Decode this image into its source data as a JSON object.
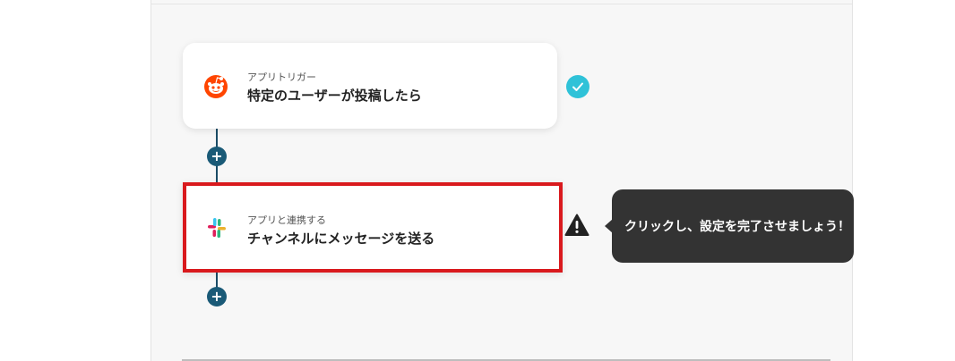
{
  "flow": {
    "steps": [
      {
        "kicker": "アプリトリガー",
        "title": "特定のユーザーが投稿したら",
        "app_icon": "reddit-icon",
        "status": "complete",
        "status_icon": "check-circle-icon"
      },
      {
        "kicker": "アプリと連携する",
        "title": "チャンネルにメッセージを送る",
        "app_icon": "slack-icon",
        "status": "warning",
        "status_icon": "warning-triangle-icon"
      }
    ],
    "add_step_icon": "+",
    "tooltip": "クリックし、設定を完了させましょう！"
  },
  "colors": {
    "check": "#2fc2d8",
    "highlight": "#d9191d",
    "connector": "#1a5a77",
    "tooltip_bg": "#333333",
    "reddit": "#ff4500"
  }
}
